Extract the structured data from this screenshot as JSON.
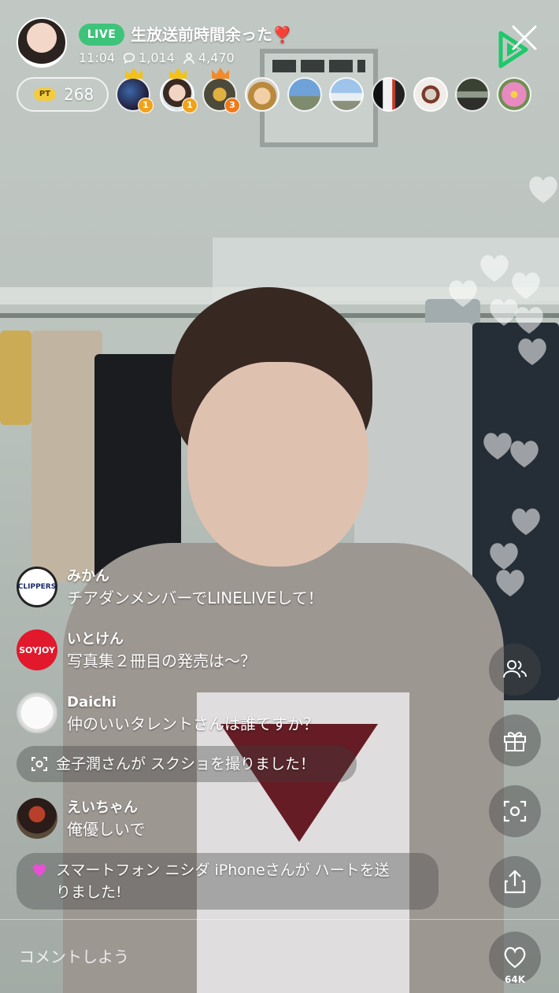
{
  "header": {
    "live_badge": "LIVE",
    "title": "生放送前時間余った",
    "title_emoji": "❣️",
    "time": "11:04",
    "comments_count": "1,014",
    "viewers_count": "4,470",
    "points_label": "PT",
    "points_value": "268",
    "viewer_ranks": [
      "1",
      "1",
      "3"
    ]
  },
  "comments": [
    {
      "name": "みかん",
      "text": "チアダンメンバーでLINELIVEして！",
      "avatar_label": "CLIPPERS"
    },
    {
      "name": "いとけん",
      "text": "写真集２冊目の発売は〜？",
      "avatar_label": "SOYJOY"
    },
    {
      "name": "Daichi",
      "text": "仲のいいタレントさんは誰ですか？",
      "avatar_label": ""
    },
    {
      "name": "えいちゃん",
      "text": "俺優しいで",
      "avatar_label": ""
    }
  ],
  "notices": {
    "screenshot": "金子潤さんが スクショを撮りました！",
    "heart_line1": "スマートフォン ニシダ iPhoneさんが ハートを送",
    "heart_line2": "りました!"
  },
  "actions": {
    "like_count": "64K"
  },
  "input": {
    "placeholder": "コメントしよう"
  },
  "colors": {
    "live_green": "#3ec37a",
    "points_yellow": "#f2cc3d",
    "heart_pink": "#e84fd6"
  },
  "icons": [
    "chat-bubble-icon",
    "person-icon",
    "close-icon",
    "line-live-logo",
    "users-icon",
    "gift-icon",
    "screenshot-icon",
    "share-icon",
    "heart-icon"
  ]
}
